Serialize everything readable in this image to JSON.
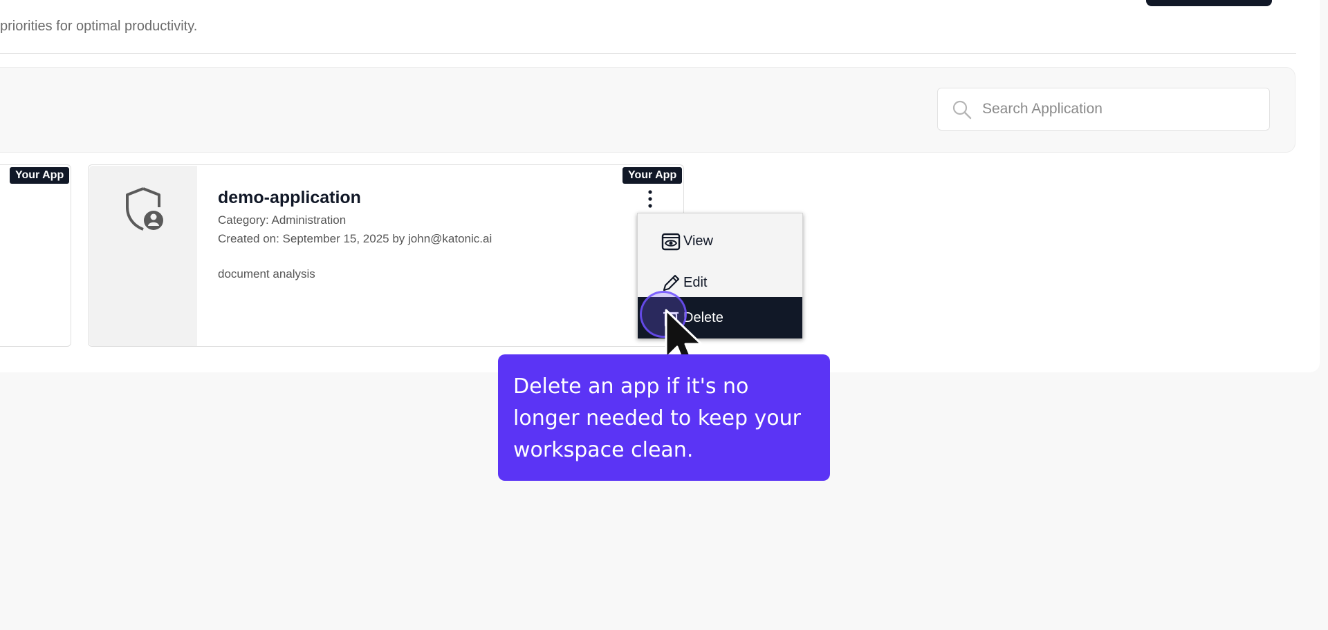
{
  "header": {
    "subtitle": "priorities for optimal productivity."
  },
  "search": {
    "placeholder": "Search Application",
    "value": ""
  },
  "cards": [
    {
      "badge": "Your App"
    },
    {
      "badge": "Your App",
      "title": "demo-application",
      "category": "Category: Administration",
      "created": "Created on: September 15, 2025 by john@katonic.ai",
      "description": "document analysis",
      "icon": "shield-user-icon"
    }
  ],
  "menu": {
    "items": [
      {
        "label": "View",
        "icon": "eye-icon"
      },
      {
        "label": "Edit",
        "icon": "pencil-icon"
      },
      {
        "label": "Delete",
        "icon": "trash-icon"
      }
    ]
  },
  "tooltip": {
    "text": "Delete an app if it's no longer needed to keep your workspace clean."
  },
  "colors": {
    "accent": "#5b34f5",
    "dark": "#111827",
    "panel": "#ffffff",
    "background": "#f8f8f8"
  }
}
